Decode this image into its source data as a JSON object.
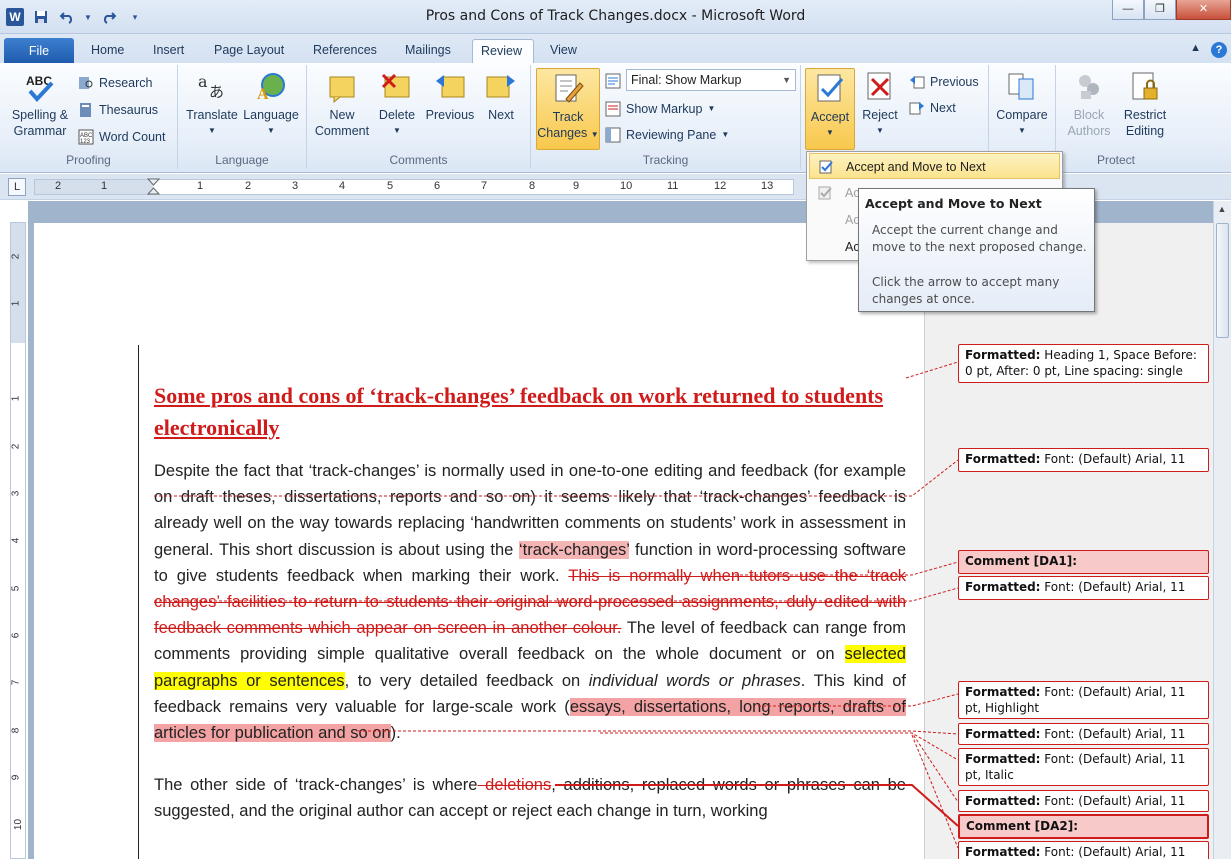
{
  "window": {
    "title": "Pros and Cons of Track Changes.docx - Microsoft Word",
    "app_letter": "W"
  },
  "tabs": [
    {
      "label": "File"
    },
    {
      "label": "Home"
    },
    {
      "label": "Insert"
    },
    {
      "label": "Page Layout"
    },
    {
      "label": "References"
    },
    {
      "label": "Mailings"
    },
    {
      "label": "Review"
    },
    {
      "label": "View"
    }
  ],
  "ribbon": {
    "proofing": {
      "label": "Proofing",
      "spelling": "Spelling &",
      "grammar": "Grammar",
      "research": "Research",
      "thesaurus": "Thesaurus",
      "word_count": "Word Count"
    },
    "language": {
      "label": "Language",
      "translate": "Translate",
      "language": "Language"
    },
    "comments": {
      "label": "Comments",
      "new_1": "New",
      "new_2": "Comment",
      "delete": "Delete",
      "previous": "Previous",
      "next": "Next"
    },
    "tracking": {
      "label": "Tracking",
      "track_1": "Track",
      "track_2": "Changes",
      "markup_value": "Final: Show Markup",
      "show_markup": "Show Markup",
      "reviewing_pane": "Reviewing Pane"
    },
    "changes": {
      "accept": "Accept",
      "reject": "Reject",
      "previous": "Previous",
      "next": "Next"
    },
    "compare": {
      "compare": "Compare"
    },
    "protect": {
      "label": "Protect",
      "block_1": "Block",
      "block_2": "Authors",
      "restrict_1": "Restrict",
      "restrict_2": "Editing"
    }
  },
  "ruler": {
    "numbers": [
      "2",
      "1",
      "1",
      "2",
      "3",
      "4",
      "5",
      "6",
      "7",
      "8",
      "9",
      "10",
      "11",
      "12",
      "13"
    ]
  },
  "vruler": {
    "numbers": [
      "2",
      "1",
      "1",
      "2",
      "3",
      "4",
      "5",
      "6",
      "7",
      "8",
      "9",
      "10"
    ]
  },
  "accept_menu": {
    "items": [
      {
        "label": "Accept and Move to Next",
        "state": "active"
      },
      {
        "label": "Ac",
        "state": "disabled"
      },
      {
        "label": "Ac",
        "state": "disabled"
      },
      {
        "label": "Ac",
        "state": "normal"
      }
    ]
  },
  "tooltip": {
    "title": "Accept and Move to Next",
    "body": "Accept the current change and move to the next proposed change.",
    "body2": "Click the arrow to accept many changes at once."
  },
  "document": {
    "heading": "Some pros and cons of ‘track-changes’ feedback on work returned to students electronically",
    "p1_a": "Despite the fact that ‘track-changes’ is normally used in one-to-one editing and feedback (for example on draft theses, dissertations, reports and so on) it seems likely that ‘track-changes’ feedback is already well on the way towards replacing ‘handwritten comments on students’ work in assessment in general. This short discussion is about using the ",
    "p1_comment": "‘track-changes’",
    "p1_b": " function in word-processing software to give students feedback when marking their work.  ",
    "p1_deleted": "This is normally when tutors use the ‘track changes’ facilities to return to students their original word-processed assignments, duly edited with feedback comments which appear on-screen in another colour.",
    "p1_c": " The level of feedback can range from comments providing simple qualitative overall feedback on the whole document or on ",
    "p1_highlight": "selected paragraphs or sentences",
    "p1_d": ", to very detailed feedback on ",
    "p1_italic": "individual words or phrases",
    "p1_e": ". This kind of feedback remains very valuable for large-scale work (",
    "p1_comment2": "essays, dissertations, long reports, drafts of articles for publication and so on",
    "p1_f": ").",
    "p2_a": "The other side of ‘track-changes’ is where",
    "p2_deleted": " deletions",
    "p2_b": ", additions, replaced words or phrases can be suggested, and the original author can accept or reject each change in turn, working"
  },
  "balloons": [
    {
      "label": "Formatted:",
      "text": " Heading 1, Space Before: 0 pt, After:  0 pt, Line spacing:  single",
      "type": "format"
    },
    {
      "label": "Formatted:",
      "text": " Font: (Default) Arial, 11",
      "type": "format"
    },
    {
      "label": "Comment [DA1]:",
      "text": "",
      "type": "comment"
    },
    {
      "label": "Formatted:",
      "text": " Font: (Default) Arial, 11",
      "type": "format"
    },
    {
      "label": "Formatted:",
      "text": " Font: (Default) Arial, 11 pt, Highlight",
      "type": "format"
    },
    {
      "label": "Formatted:",
      "text": " Font: (Default) Arial, 11",
      "type": "format"
    },
    {
      "label": "Formatted:",
      "text": " Font: (Default) Arial, 11 pt, Italic",
      "type": "format"
    },
    {
      "label": "Formatted:",
      "text": " Font: (Default) Arial, 11",
      "type": "format"
    },
    {
      "label": "Comment [DA2]:",
      "text": "",
      "type": "comment"
    },
    {
      "label": "Formatted:",
      "text": " Font: (Default) Arial, 11",
      "type": "format"
    }
  ]
}
